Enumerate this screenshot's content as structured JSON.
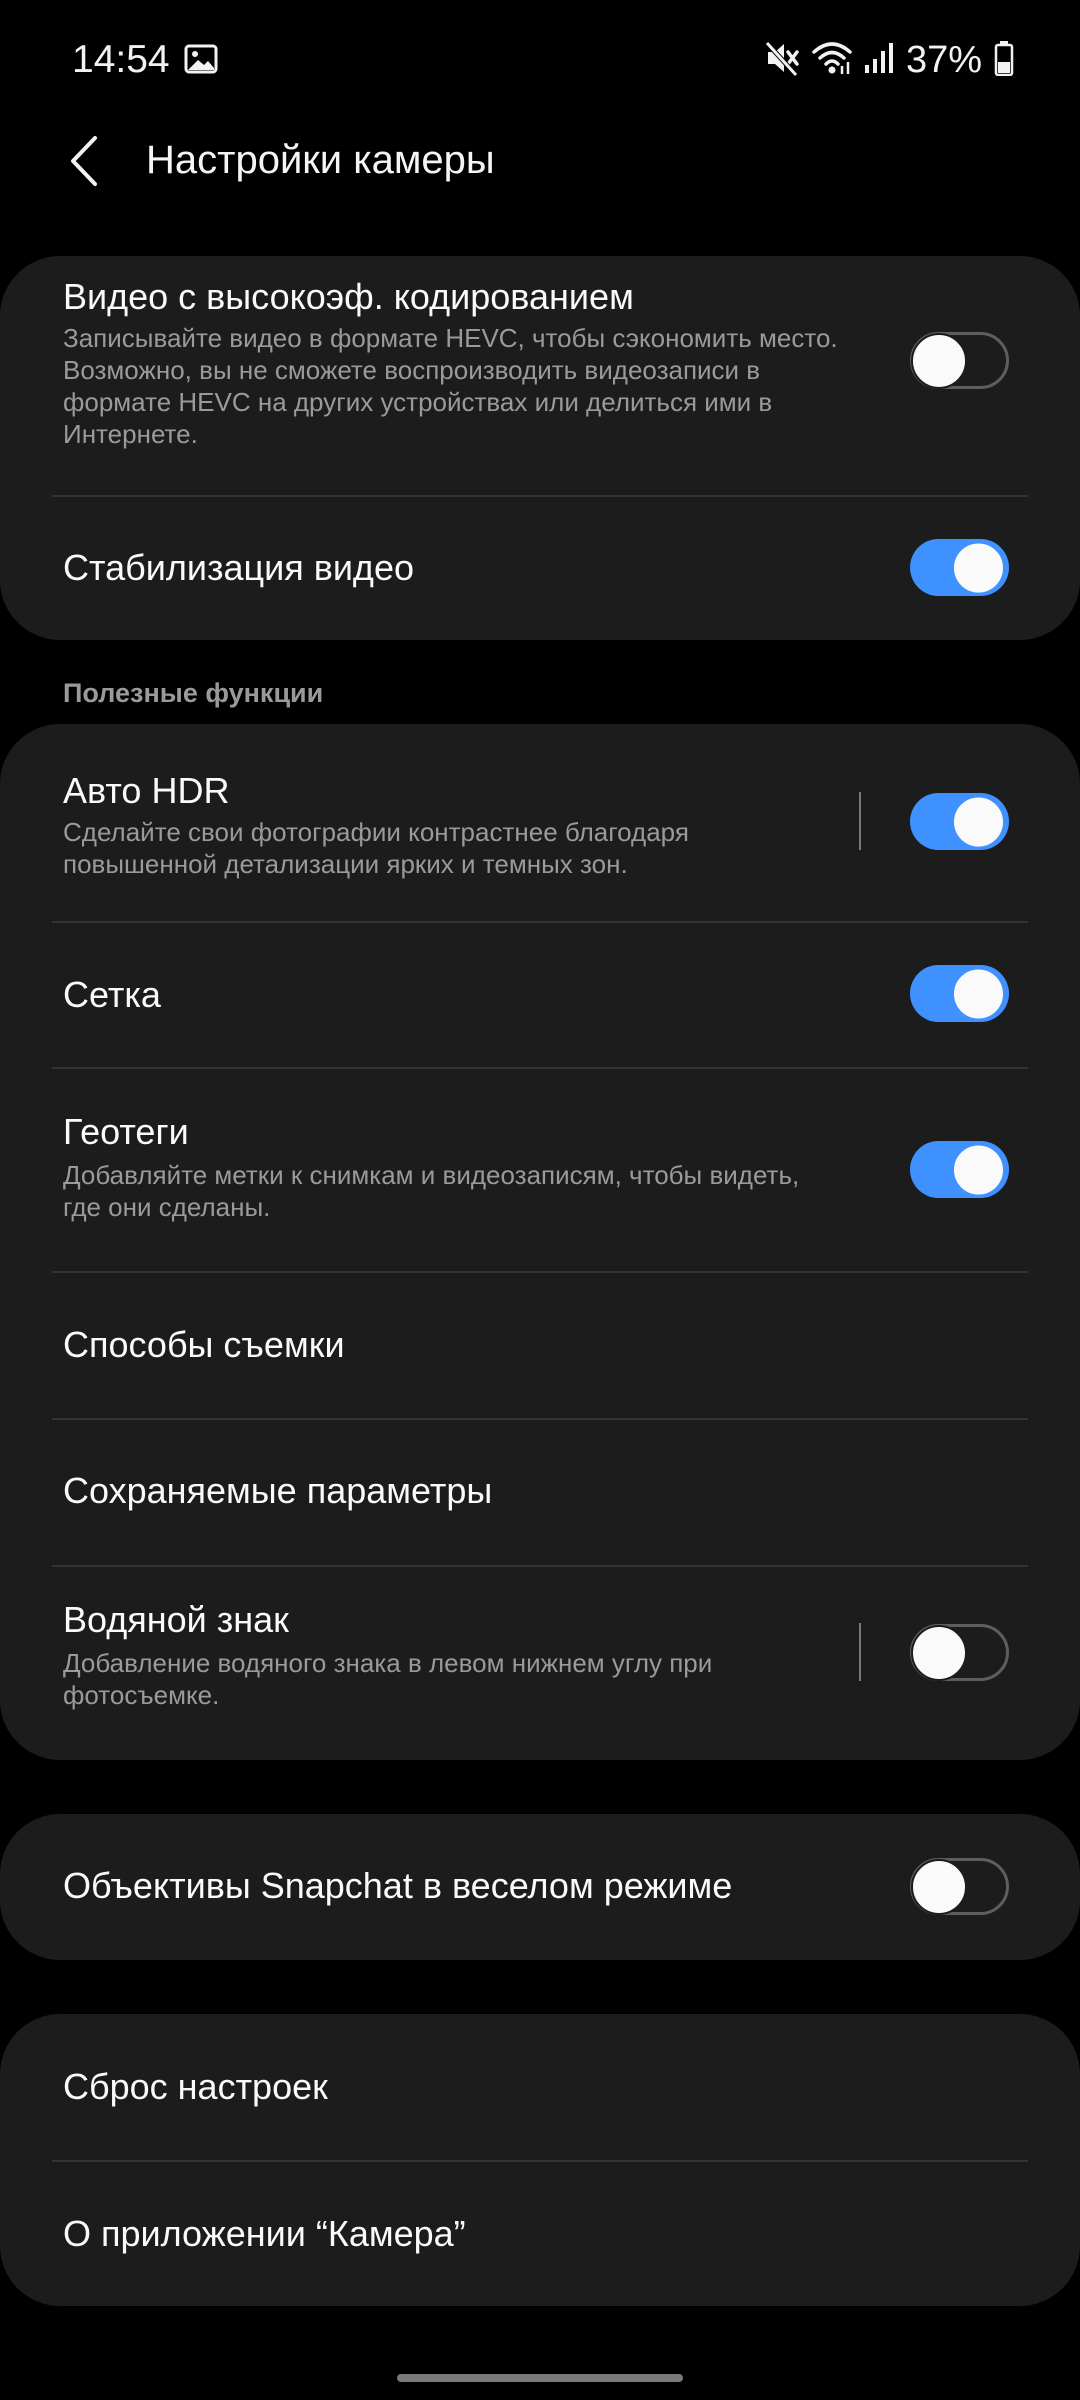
{
  "status_bar": {
    "time": "14:54",
    "battery_percent": "37%",
    "icons": [
      "gallery-icon",
      "mute-icon",
      "wifi-icon",
      "signal-icon",
      "battery-icon"
    ]
  },
  "header": {
    "back_icon": "chevron-left-icon",
    "title": "Настройки камеры"
  },
  "card1": {
    "hevc": {
      "title": "Видео с высокоэф. кодированием",
      "subtitle": "Записывайте видео в формате HEVC, чтобы сэкономить место. Возможно, вы не сможете воспроизводить видеозаписи в формате HEVC на других устройствах или делиться ими в Интернете.",
      "enabled": false
    },
    "stabilization": {
      "title": "Стабилизация видео",
      "enabled": true
    }
  },
  "section_label": "Полезные функции",
  "card2": {
    "auto_hdr": {
      "title": "Авто HDR",
      "subtitle": "Сделайте свои фотографии контрастнее благодаря повышенной детализации ярких и темных зон.",
      "enabled": true
    },
    "grid": {
      "title": "Сетка",
      "enabled": true
    },
    "geotags": {
      "title": "Геотеги",
      "subtitle": "Добавляйте метки к снимкам и видеозаписям, чтобы видеть, где они сделаны.",
      "enabled": true
    },
    "shooting_methods": {
      "title": "Способы съемки"
    },
    "saved_settings": {
      "title": "Сохраняемые параметры"
    },
    "watermark": {
      "title": "Водяной знак",
      "subtitle": "Добавление водяного знака в левом нижнем углу при фотосъемке.",
      "enabled": false
    }
  },
  "card3": {
    "snapchat": {
      "title": "Объективы Snapchat в веселом режиме",
      "enabled": false
    }
  },
  "card4": {
    "reset": {
      "title": "Сброс настроек"
    },
    "about": {
      "title": "О приложении “Камера”"
    }
  },
  "colors": {
    "background": "#000000",
    "card": "#1c1c1c",
    "accent": "#3e91ff",
    "subtitle": "#9a9a9a"
  }
}
